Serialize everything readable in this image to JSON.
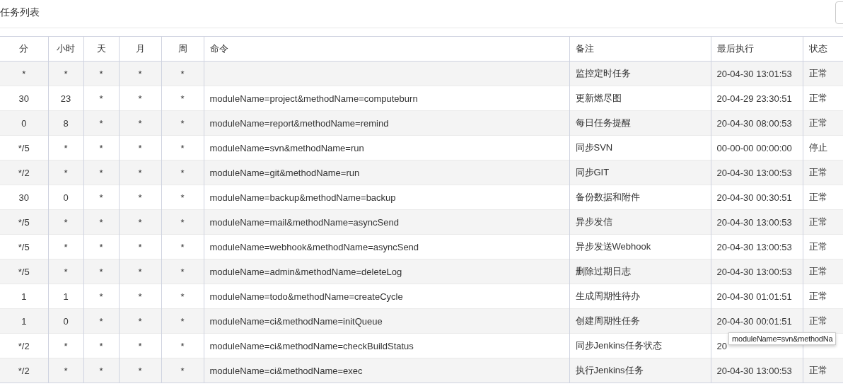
{
  "title": "任务列表",
  "table": {
    "columns": [
      "分",
      "小时",
      "天",
      "月",
      "周",
      "命令",
      "备注",
      "最后执行",
      "状态"
    ],
    "rows": [
      {
        "cells": [
          "*",
          "*",
          "*",
          "*",
          "*",
          "",
          "监控定时任务",
          "20-04-30 13:01:53",
          "正常"
        ]
      },
      {
        "cells": [
          "30",
          "23",
          "*",
          "*",
          "*",
          "moduleName=project&methodName=computeburn",
          "更新燃尽图",
          "20-04-29 23:30:51",
          "正常"
        ]
      },
      {
        "cells": [
          "0",
          "8",
          "*",
          "*",
          "*",
          "moduleName=report&methodName=remind",
          "每日任务提醒",
          "20-04-30 08:00:53",
          "正常"
        ]
      },
      {
        "cells": [
          "*/5",
          "*",
          "*",
          "*",
          "*",
          "moduleName=svn&methodName=run",
          "同步SVN",
          "00-00-00 00:00:00",
          "停止"
        ]
      },
      {
        "cells": [
          "*/2",
          "*",
          "*",
          "*",
          "*",
          "moduleName=git&methodName=run",
          "同步GIT",
          "20-04-30 13:00:53",
          "正常"
        ]
      },
      {
        "cells": [
          "30",
          "0",
          "*",
          "*",
          "*",
          "moduleName=backup&methodName=backup",
          "备份数据和附件",
          "20-04-30 00:30:51",
          "正常"
        ]
      },
      {
        "cells": [
          "*/5",
          "*",
          "*",
          "*",
          "*",
          "moduleName=mail&methodName=asyncSend",
          "异步发信",
          "20-04-30 13:00:53",
          "正常"
        ]
      },
      {
        "cells": [
          "*/5",
          "*",
          "*",
          "*",
          "*",
          "moduleName=webhook&methodName=asyncSend",
          "异步发送Webhook",
          "20-04-30 13:00:53",
          "正常"
        ]
      },
      {
        "cells": [
          "*/5",
          "*",
          "*",
          "*",
          "*",
          "moduleName=admin&methodName=deleteLog",
          "删除过期日志",
          "20-04-30 13:00:53",
          "正常"
        ]
      },
      {
        "cells": [
          "1",
          "1",
          "*",
          "*",
          "*",
          "moduleName=todo&methodName=createCycle",
          "生成周期性待办",
          "20-04-30 01:01:51",
          "正常"
        ]
      },
      {
        "cells": [
          "1",
          "0",
          "*",
          "*",
          "*",
          "moduleName=ci&methodName=initQueue",
          "创建周期性任务",
          "20-04-30 00:01:51",
          "正常"
        ]
      },
      {
        "cells": [
          "*/2",
          "*",
          "*",
          "*",
          "*",
          "moduleName=ci&methodName=checkBuildStatus",
          "同步Jenkins任务状态",
          "20"
        ]
      },
      {
        "cells": [
          "*/2",
          "*",
          "*",
          "*",
          "*",
          "moduleName=ci&methodName=exec",
          "执行Jenkins任务",
          "20-04-30 13:00:53",
          "正常"
        ]
      }
    ]
  },
  "tooltip": "moduleName=svn&methodNa"
}
